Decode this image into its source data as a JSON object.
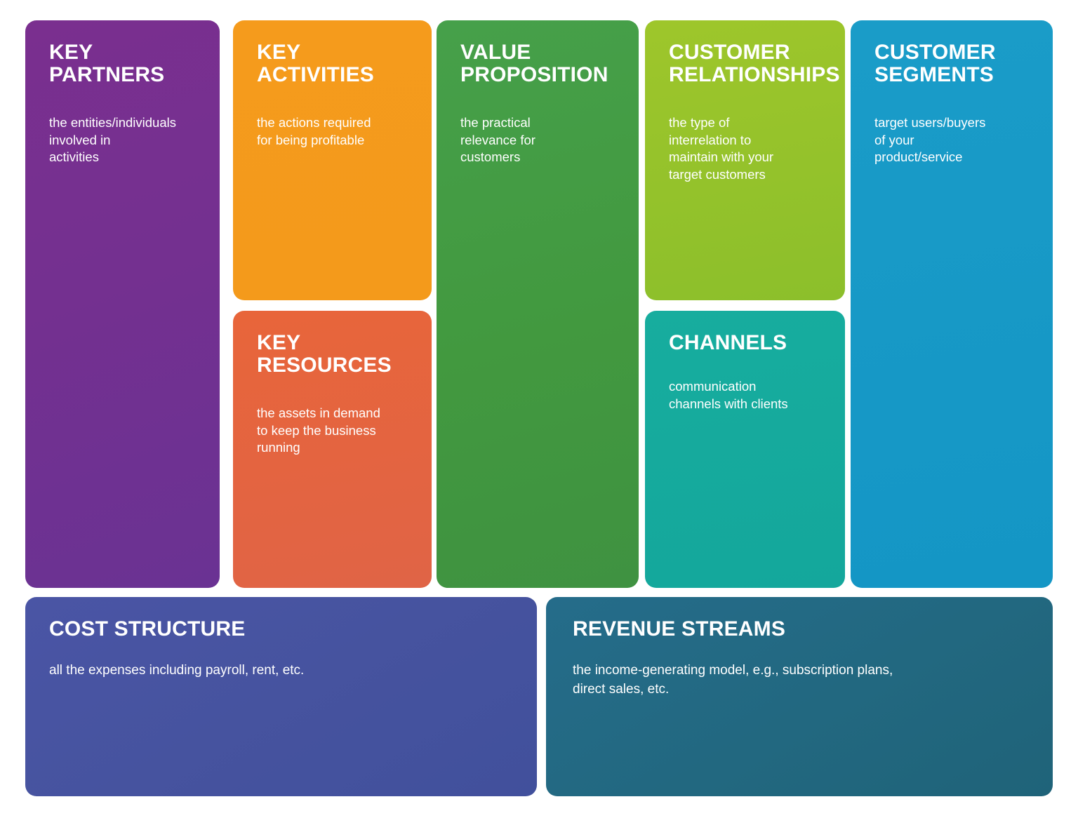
{
  "document": {
    "type": "business-model-canvas",
    "background_color": "#ffffff"
  },
  "blocks": {
    "key_partners": {
      "title": "KEY\nPARTNERS",
      "description": "the entities/individuals\ninvolved in\nactivities",
      "color": "#743090"
    },
    "key_activities": {
      "title": "KEY\nACTIVITIES",
      "description": "the actions required\nfor being profitable",
      "color": "#f49a1b"
    },
    "key_resources": {
      "title": "KEY\nRESOURCES",
      "description": "the assets in demand\nto keep the business\nrunning",
      "color": "#e0644a"
    },
    "value_proposition": {
      "title": "VALUE\nPROPOSITION",
      "description": "the practical\nrelevance for\ncustomers",
      "color": "#42993f"
    },
    "customer_relationships": {
      "title": "CUSTOMER\nRELATIONSHIPS",
      "description": "the type of\ninterrelation to\nmaintain with your\ntarget customers",
      "color": "#8cbf2b"
    },
    "channels": {
      "title": "CHANNELS",
      "description": "communication\nchannels with clients",
      "color": "#14a79c"
    },
    "customer_segments": {
      "title": "CUSTOMER\nSEGMENTS",
      "description": "target users/buyers\nof your\nproduct/service",
      "color": "#1496c5"
    },
    "cost_structure": {
      "title": "COST STRUCTURE",
      "description": "all the expenses including payroll, rent, etc.",
      "color": "#46539f"
    },
    "revenue_streams": {
      "title": "REVENUE STREAMS",
      "description": "the income-generating model, e.g., subscription plans,\ndirect sales, etc.",
      "color": "#226880"
    }
  }
}
